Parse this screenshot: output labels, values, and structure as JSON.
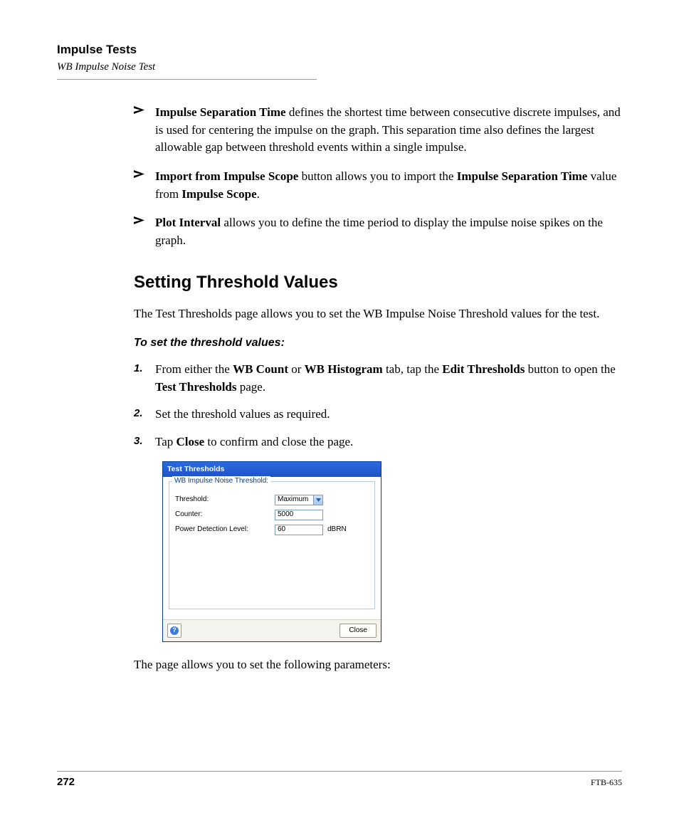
{
  "header": {
    "title": "Impulse Tests",
    "subtitle": "WB Impulse Noise Test"
  },
  "bullets": [
    {
      "bold": "Impulse Separation Time",
      "rest": " defines the shortest time between consecutive discrete impulses, and is used for centering the impulse on the graph. This separation time also defines the largest allowable gap between threshold events within a single impulse."
    },
    {
      "segments": [
        {
          "b": true,
          "t": "Import from Impulse Scope"
        },
        {
          "b": false,
          "t": " button allows you to import the "
        },
        {
          "b": true,
          "t": "Impulse Separation Time"
        },
        {
          "b": false,
          "t": " value from "
        },
        {
          "b": true,
          "t": "Impulse Scope"
        },
        {
          "b": false,
          "t": "."
        }
      ]
    },
    {
      "bold": "Plot Interval",
      "rest": " allows you to define the time period to display the impulse noise spikes on the graph."
    }
  ],
  "section_heading": "Setting Threshold Values",
  "intro_segments": [
    {
      "b": false,
      "t": "The "
    },
    {
      "b": true,
      "t": "Test Thresholds"
    },
    {
      "b": false,
      "t": " page allows you to set the "
    },
    {
      "b": true,
      "t": "WB Impulse Noise Threshold"
    },
    {
      "b": false,
      "t": " values for the test."
    }
  ],
  "subheading": "To set the threshold values:",
  "steps": [
    {
      "marker": "1.",
      "segments": [
        {
          "b": false,
          "t": "From either the "
        },
        {
          "b": true,
          "t": "WB Count"
        },
        {
          "b": false,
          "t": " or "
        },
        {
          "b": true,
          "t": "WB Histogram"
        },
        {
          "b": false,
          "t": " tab, tap the "
        },
        {
          "b": true,
          "t": "Edit Thresholds"
        },
        {
          "b": false,
          "t": " button to open the "
        },
        {
          "b": true,
          "t": "Test Thresholds"
        },
        {
          "b": false,
          "t": " page."
        }
      ]
    },
    {
      "marker": "2.",
      "segments": [
        {
          "b": false,
          "t": "Set the threshold values as required."
        }
      ]
    },
    {
      "marker": "3.",
      "segments": [
        {
          "b": false,
          "t": "Tap "
        },
        {
          "b": true,
          "t": "Close"
        },
        {
          "b": false,
          "t": " to confirm and close the page."
        }
      ]
    }
  ],
  "dialog": {
    "title": "Test Thresholds",
    "group_label": "WB Impulse Noise Threshold:",
    "fields": {
      "threshold_label": "Threshold:",
      "threshold_value": "Maximum",
      "counter_label": "Counter:",
      "counter_value": "5000",
      "power_label": "Power Detection Level:",
      "power_value": "60",
      "power_unit": "dBRN"
    },
    "help_glyph": "?",
    "close_label": "Close"
  },
  "outro": "The page allows you to set the following parameters:",
  "footer": {
    "page": "272",
    "docid": "FTB-635"
  }
}
